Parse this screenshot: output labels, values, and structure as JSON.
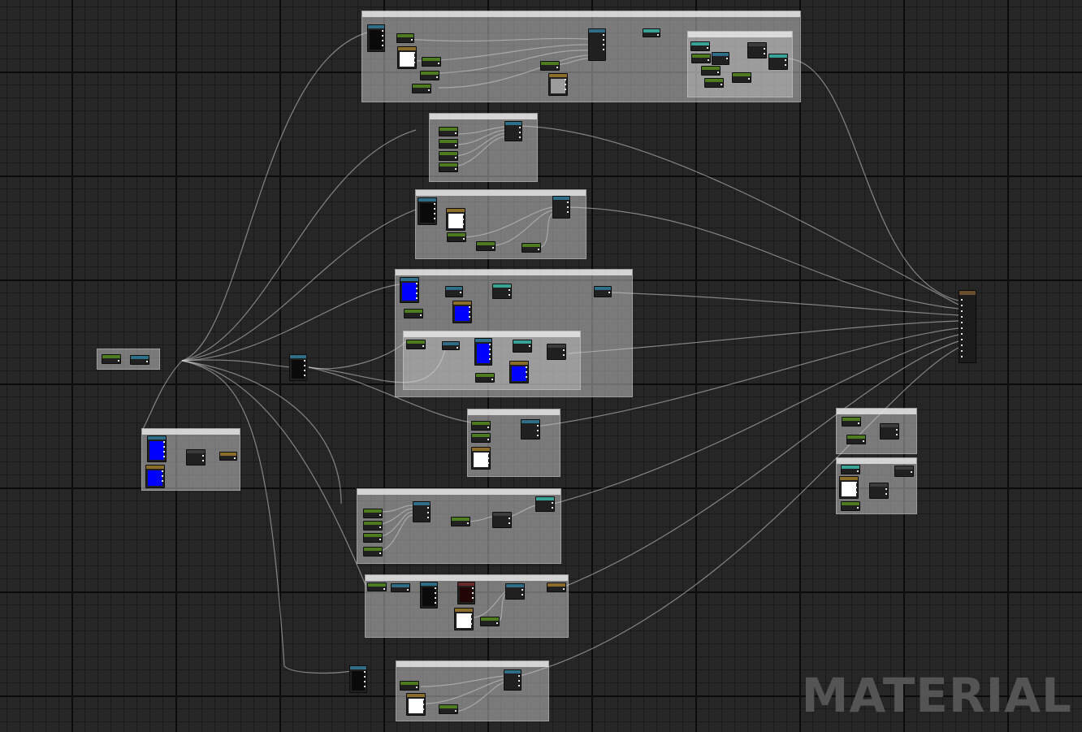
{
  "editor": {
    "graph_title": "MATERIAL"
  },
  "colors": {
    "grid_background": "#262626",
    "comment_box": "#cdcdcd",
    "wire": "#c8c8c8",
    "parameter_header": "#2f6e86",
    "constant_header": "#4e7a20",
    "texture_header": "#8a6d2a",
    "function_header": "#3aa398",
    "result_header": "#6b4e2e",
    "swatch_blue": "#0000ff",
    "swatch_white": "#ffffff"
  },
  "result_node": {
    "name": "material-result-node",
    "input_pin_count": 11
  },
  "comment_labels": {
    "base_color": "",
    "base_color_sub": "",
    "metallic": "",
    "roughness": "",
    "normal": "",
    "normal_sub": "",
    "ao": "",
    "emissive": "",
    "opacity": "",
    "tangent": "",
    "left_group": "",
    "right_top": "",
    "right_bottom": ""
  }
}
